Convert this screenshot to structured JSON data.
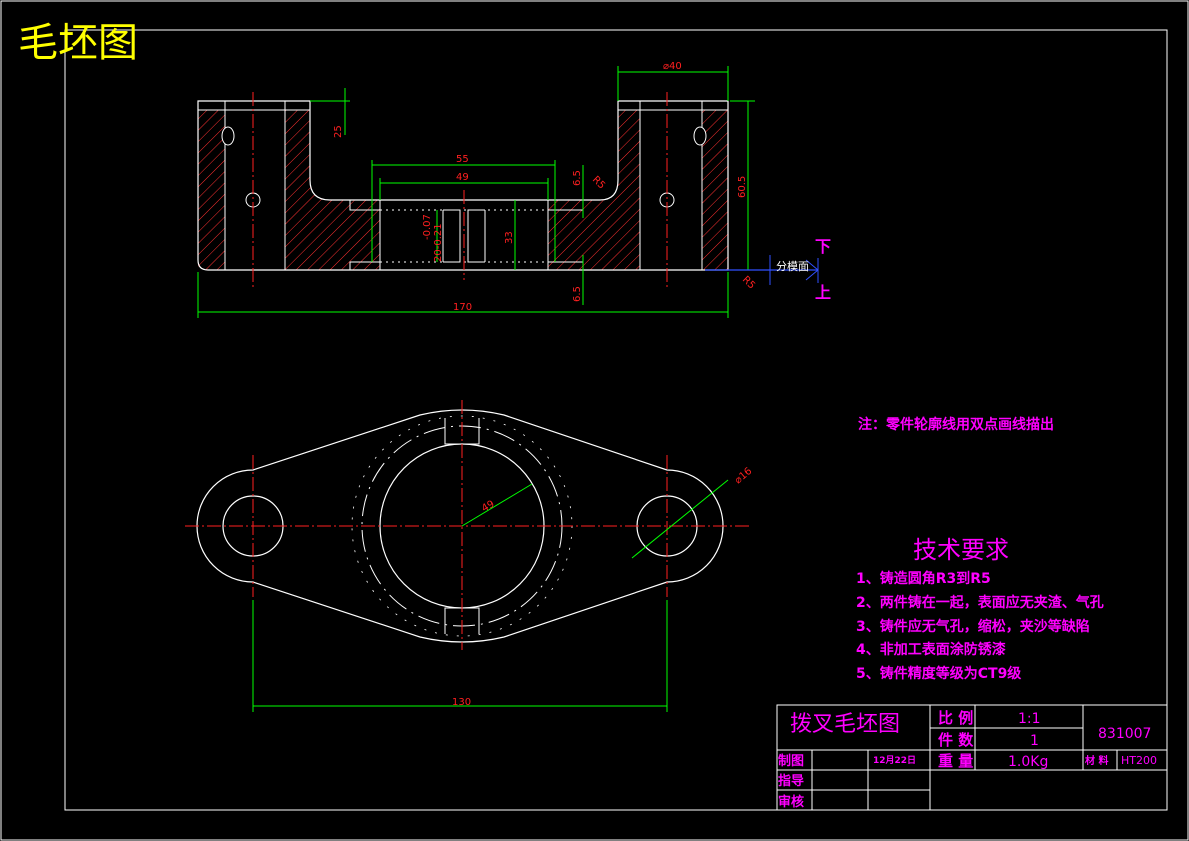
{
  "sheet_title": "毛坯图",
  "front_view": {
    "dims": {
      "d40": "⌀40",
      "h25": "25",
      "w55": "55",
      "w49": "49",
      "h6_5a": "6.5",
      "r5": "R5",
      "h60_5": "60.5",
      "tol_upper": "-0.07",
      "tol_lower": "20-0.21",
      "h33": "33",
      "h6_5b": "6.5",
      "w170": "170",
      "r5b": "R5"
    },
    "parting": {
      "label": "分模面",
      "down": "下",
      "up": "上"
    }
  },
  "top_view": {
    "dims": {
      "r49": "49",
      "d16": "⌀16",
      "w130": "130"
    }
  },
  "note": "注：零件轮廓线用双点画线描出",
  "tech_req": {
    "title": "技术要求",
    "items": [
      "1、铸造圆角R3到R5",
      "2、两件铸在一起，表面应无夹渣、气孔",
      "3、铸件应无气孔，缩松，夹沙等缺陷",
      "4、非加工表面涂防锈漆",
      "5、铸件精度等级为CT9级"
    ]
  },
  "title_block": {
    "name": "拨叉毛坯图",
    "scale_label": "比 例",
    "scale_value": "1:1",
    "qty_label": "件 数",
    "qty_value": "1",
    "weight_label": "重 量",
    "weight_value": "1.0Kg",
    "drawing_no": "831007",
    "material_label": "材 料",
    "material_value": "HT200",
    "drawn_label": "制图",
    "date": "12月22日",
    "guide_label": "指导",
    "review_label": "审核"
  },
  "colors": {
    "outline": "#ffffff",
    "hatch": "#ff3030",
    "center": "#ff2020",
    "dimension": "#00ff00",
    "magenta": "#ff00ff",
    "title": "#ffff00",
    "blue": "#3050ff"
  }
}
